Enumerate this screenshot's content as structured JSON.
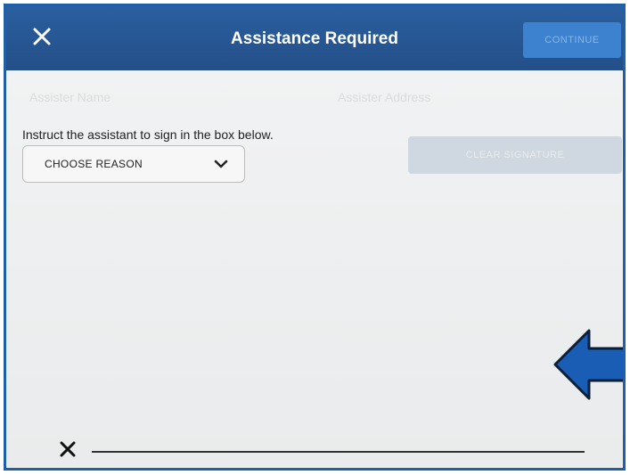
{
  "header": {
    "title": "Assistance Required",
    "continue_label": "CONTINUE",
    "close_icon": "close-icon"
  },
  "form": {
    "assister_name_label": "Assister Name",
    "assister_address_label": "Assister Address",
    "instruction": "Instruct the assistant to sign in the box below.",
    "reason_select_value": "CHOOSE REASON",
    "faded_button_label": "CLEAR SIGNATURE"
  },
  "signature": {
    "x_mark_icon": "signature-x-icon"
  },
  "colors": {
    "header_bg": "#2a5fa0",
    "frame_border": "#1f5fa8",
    "arrow_fill": "#1a5db5"
  }
}
